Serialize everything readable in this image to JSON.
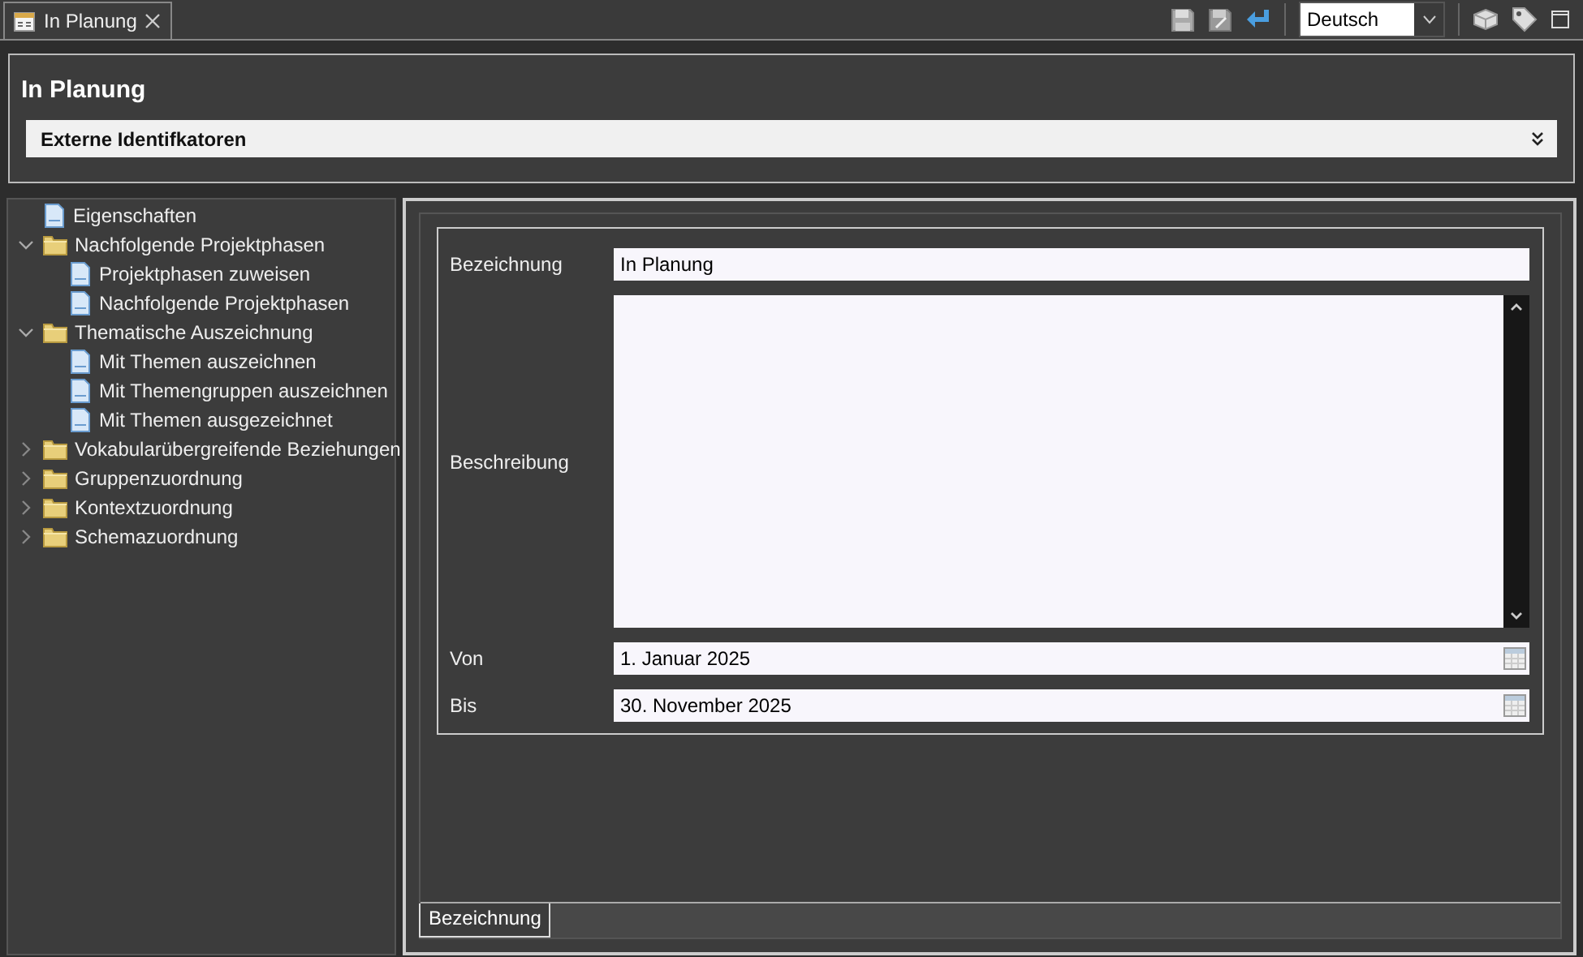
{
  "editor_tab": {
    "title": "In Planung"
  },
  "toolbar": {
    "language": "Deutsch"
  },
  "header": {
    "title": "In Planung",
    "section": {
      "title": "Externe Identifkatoren",
      "expanded": false
    }
  },
  "tree": [
    {
      "label": "Eigenschaften",
      "kind": "page"
    },
    {
      "label": "Nachfolgende Projektphasen",
      "kind": "folder",
      "expanded": true,
      "children": [
        {
          "label": "Projektphasen zuweisen",
          "kind": "page"
        },
        {
          "label": "Nachfolgende Projektphasen",
          "kind": "page"
        }
      ]
    },
    {
      "label": "Thematische Auszeichnung",
      "kind": "folder",
      "expanded": true,
      "children": [
        {
          "label": "Mit Themen auszeichnen",
          "kind": "page"
        },
        {
          "label": "Mit Themengruppen auszeichnen",
          "kind": "page"
        },
        {
          "label": "Mit Themen ausgezeichnet",
          "kind": "page"
        }
      ]
    },
    {
      "label": "Vokabularübergreifende Beziehungen",
      "kind": "folder",
      "expanded": false
    },
    {
      "label": "Gruppenzuordnung",
      "kind": "folder",
      "expanded": false
    },
    {
      "label": "Kontextzuordnung",
      "kind": "folder",
      "expanded": false
    },
    {
      "label": "Schemazuordnung",
      "kind": "folder",
      "expanded": false
    }
  ],
  "form": {
    "fields": [
      {
        "label": "Bezeichnung",
        "kind": "text",
        "value": "In Planung"
      },
      {
        "label": "Beschreibung",
        "kind": "textarea"
      },
      {
        "label": "Von",
        "kind": "date",
        "value": "1. Januar 2025"
      },
      {
        "label": "Bis",
        "kind": "date",
        "value": "30. November 2025"
      }
    ]
  },
  "bottom_tabs": [
    {
      "label": "Bezeichnung",
      "selected": true
    }
  ]
}
